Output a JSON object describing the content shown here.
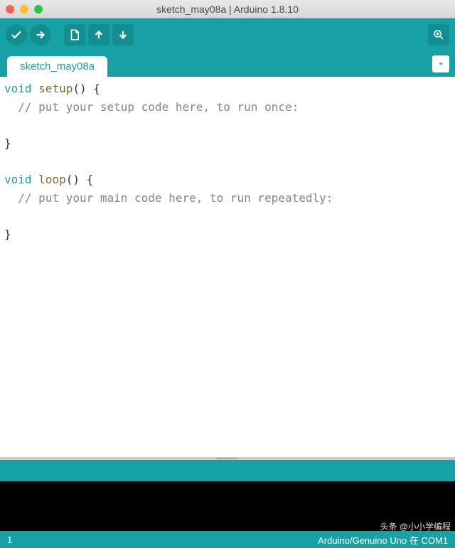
{
  "window": {
    "title": "sketch_may08a | Arduino 1.8.10"
  },
  "tabs": {
    "active": "sketch_may08a"
  },
  "editor": {
    "lines": [
      {
        "tokens": [
          {
            "t": "void ",
            "c": "kw"
          },
          {
            "t": "setup",
            "c": "fn"
          },
          {
            "t": "() {",
            "c": ""
          }
        ]
      },
      {
        "tokens": [
          {
            "t": "  // put your setup code here, to run once:",
            "c": "cm"
          }
        ]
      },
      {
        "tokens": [
          {
            "t": "",
            "c": ""
          }
        ]
      },
      {
        "tokens": [
          {
            "t": "}",
            "c": ""
          }
        ]
      },
      {
        "tokens": [
          {
            "t": "",
            "c": ""
          }
        ]
      },
      {
        "tokens": [
          {
            "t": "void ",
            "c": "kw"
          },
          {
            "t": "loop",
            "c": "fn"
          },
          {
            "t": "() {",
            "c": ""
          }
        ]
      },
      {
        "tokens": [
          {
            "t": "  // put your main code here, to run repeatedly:",
            "c": "cm"
          }
        ]
      },
      {
        "tokens": [
          {
            "t": "",
            "c": ""
          }
        ]
      },
      {
        "tokens": [
          {
            "t": "}",
            "c": ""
          }
        ]
      }
    ]
  },
  "footer": {
    "line_number": "1",
    "board": "Arduino/Genuino Uno 在 COM1"
  },
  "watermark": "头条 @小小学编程"
}
